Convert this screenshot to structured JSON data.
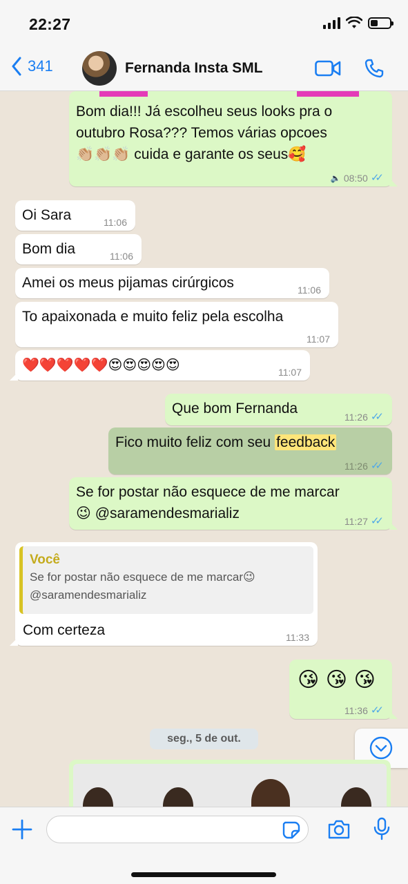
{
  "status_bar": {
    "time": "22:27"
  },
  "header": {
    "back_count": "341",
    "contact_name": "Fernanda Insta SML"
  },
  "messages": {
    "m1": {
      "text_line1": "Bom dia!!! Já escolheu seus looks pra o",
      "text_line2": "outubro Rosa??? Temos várias opcoes",
      "text_line3_emoji": "👏🏼👏🏼👏🏼",
      "text_line3": " cuida e garante os seus",
      "text_line3_end": "🥰",
      "time": "08:50"
    },
    "m2": {
      "text": "Oi Sara",
      "time": "11:06"
    },
    "m3": {
      "text": "Bom dia",
      "time": "11:06"
    },
    "m4": {
      "text": "Amei os meus pijamas cirúrgicos",
      "time": "11:06"
    },
    "m5": {
      "text": "To apaixonada e muito feliz pela escolha",
      "time": "11:07"
    },
    "m6": {
      "text": "❤️❤️❤️❤️❤️😍😍😍😍😍",
      "time": "11:07"
    },
    "m7": {
      "text": "Que bom Fernanda",
      "time": "11:26"
    },
    "m8": {
      "text_before": "Fico muito feliz com seu ",
      "highlight": "feedback",
      "time": "11:26"
    },
    "m9": {
      "text_line1": "Se for postar não esquece de me marcar",
      "text_line2_emoji": "😉",
      "text_line2": " @saramendesmarializ",
      "time": "11:27"
    },
    "m10": {
      "quote_author": "Você",
      "quote_line1": "Se for postar não esquece de me marcar😉",
      "quote_line2": "@saramendesmarializ",
      "text": "Com certeza",
      "time": "11:33"
    },
    "m11": {
      "text": "😘 😘 😘",
      "time": "11:36"
    }
  },
  "date_separator": "seg., 5 de out.",
  "input": {
    "placeholder": ""
  },
  "colors": {
    "accent": "#1a7ef2",
    "outgoing_bubble": "#dcf8c6",
    "incoming_bubble": "#ffffff",
    "read_ticks": "#4fa8e8",
    "chat_background": "#ece4d9"
  },
  "icons": [
    "back-chevron-icon",
    "video-call-icon",
    "phone-icon",
    "plus-icon",
    "sticker-icon",
    "camera-icon",
    "microphone-icon",
    "chevron-down-icon",
    "double-tick-icon",
    "megaphone-icon"
  ]
}
